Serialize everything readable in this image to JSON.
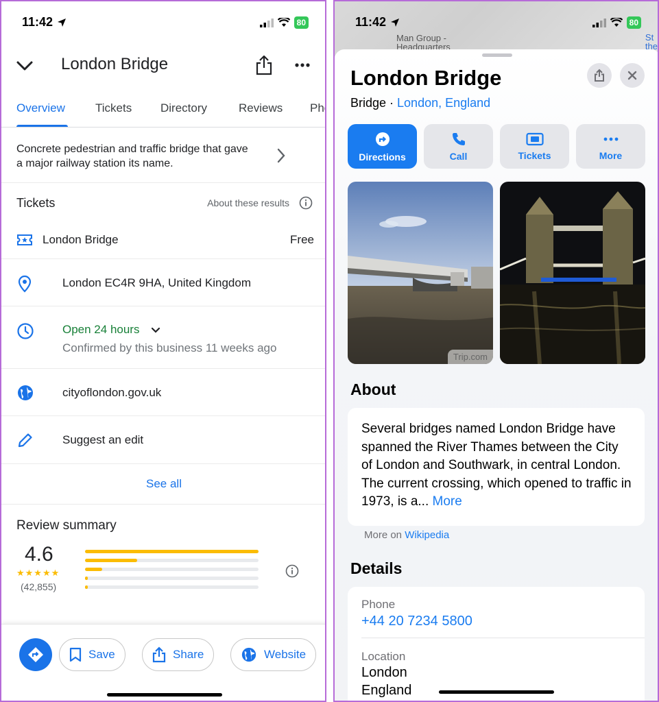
{
  "left": {
    "status": {
      "time": "11:42",
      "battery": "80"
    },
    "header": {
      "title": "London Bridge"
    },
    "tabs": [
      "Overview",
      "Tickets",
      "Directory",
      "Reviews",
      "Pho"
    ],
    "description": "Concrete pedestrian and traffic bridge that gave a major railway station its name.",
    "tickets": {
      "title": "Tickets",
      "about": "About these results",
      "item_name": "London Bridge",
      "item_price": "Free"
    },
    "address": "London EC4R 9HA, United Kingdom",
    "hours": {
      "status": "Open 24 hours",
      "confirmed": "Confirmed by this business 11 weeks ago"
    },
    "website": "cityoflondon.gov.uk",
    "suggest_edit": "Suggest an edit",
    "see_all": "See all",
    "review": {
      "title": "Review summary",
      "rating": "4.6",
      "stars": "★★★★★",
      "count": "(42,855)",
      "bar_fractions": [
        1.0,
        0.3,
        0.1,
        0.01,
        0.01
      ]
    },
    "bottom": {
      "save": "Save",
      "share": "Share",
      "website": "Website"
    }
  },
  "right": {
    "status": {
      "time": "11:42",
      "battery": "80"
    },
    "map": {
      "label1_line1": "Man Group -",
      "label1_line2": "Headquarters",
      "label2_line1": "St",
      "label2_line2": "the"
    },
    "title": "London Bridge",
    "subtitle": {
      "type": "Bridge · ",
      "location": "London, England"
    },
    "actions": [
      "Directions",
      "Call",
      "Tickets",
      "More"
    ],
    "photo_credit": "Trip.com",
    "about": {
      "title": "About",
      "text": "Several bridges named London Bridge have spanned the River Thames between the City of London and Southwark, in central London. The current crossing, which opened to traffic in 1973, is a...",
      "more": "More",
      "source_prefix": "More on ",
      "source": "Wikipedia"
    },
    "details": {
      "title": "Details",
      "phone_label": "Phone",
      "phone": "+44 20 7234 5800",
      "location_label": "Location",
      "location_line1": "London",
      "location_line2": "England"
    }
  },
  "colors": {
    "google_blue": "#1a73e8",
    "apple_blue": "#1a7cf0",
    "star_yellow": "#fbbc04",
    "open_green": "#188038",
    "frame_purple": "#b66bd8"
  }
}
